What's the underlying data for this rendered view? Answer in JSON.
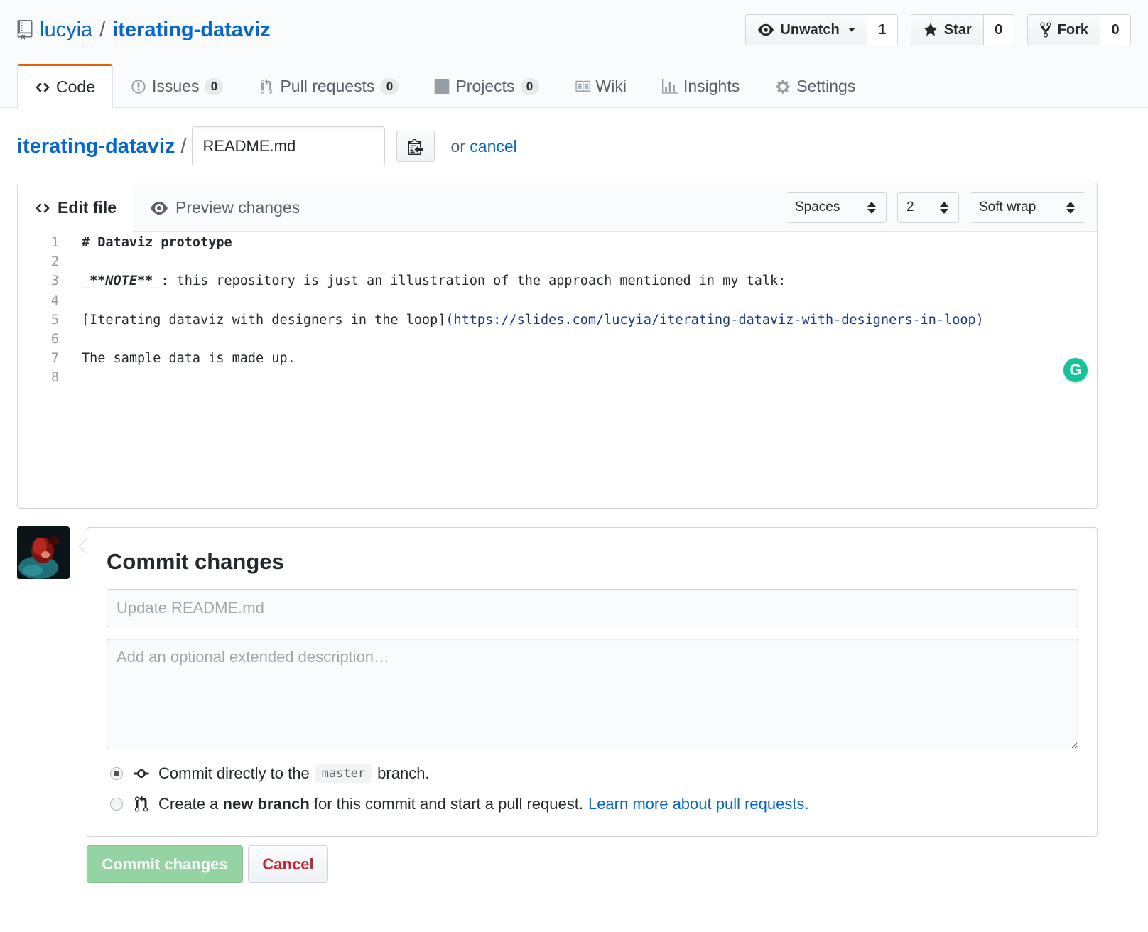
{
  "repo": {
    "owner": "lucyia",
    "separator": "/",
    "name": "iterating-dataviz"
  },
  "actions": {
    "watch": {
      "label": "Unwatch",
      "count": "1"
    },
    "star": {
      "label": "Star",
      "count": "0"
    },
    "fork": {
      "label": "Fork",
      "count": "0"
    }
  },
  "nav": {
    "code": "Code",
    "issues": "Issues",
    "issues_count": "0",
    "pulls": "Pull requests",
    "pulls_count": "0",
    "projects": "Projects",
    "projects_count": "0",
    "wiki": "Wiki",
    "insights": "Insights",
    "settings": "Settings"
  },
  "path": {
    "repo_link": "iterating-dataviz",
    "slash": "/",
    "filename": "README.md",
    "or": "or",
    "cancel": "cancel"
  },
  "editor": {
    "tab_edit": "Edit file",
    "tab_preview": "Preview changes",
    "indent_mode": "Spaces",
    "indent_size": "2",
    "wrap_mode": "Soft wrap",
    "lines": [
      {
        "n": "1",
        "parts": [
          {
            "t": "# Dataviz prototype",
            "s": "h1"
          }
        ]
      },
      {
        "n": "2",
        "parts": []
      },
      {
        "n": "3",
        "parts": [
          {
            "t": "_",
            "s": ""
          },
          {
            "t": "**NOTE**",
            "s": "bi"
          },
          {
            "t": "_: this repository is just an illustration of the approach mentioned in my talk:",
            "s": ""
          }
        ]
      },
      {
        "n": "4",
        "parts": []
      },
      {
        "n": "5",
        "parts": [
          {
            "t": "[Iterating dataviz with designers in the loop]",
            "s": "ul"
          },
          {
            "t": "(https://slides.com/lucyia/iterating-dataviz-with-designers-in-loop)",
            "s": "url"
          }
        ]
      },
      {
        "n": "6",
        "parts": []
      },
      {
        "n": "7",
        "parts": [
          {
            "t": "The sample data is made up.",
            "s": ""
          }
        ]
      },
      {
        "n": "8",
        "parts": []
      }
    ]
  },
  "commit": {
    "title": "Commit changes",
    "summary_placeholder": "Update README.md",
    "description_placeholder": "Add an optional extended description…",
    "option_direct_prefix": "Commit directly to the",
    "option_direct_branch": "master",
    "option_direct_suffix": "branch.",
    "option_new_prefix": "Create a",
    "option_new_bold": "new branch",
    "option_new_suffix": "for this commit and start a pull request.",
    "option_new_link": "Learn more about pull requests.",
    "selected_option": "direct",
    "submit_label": "Commit changes",
    "cancel_label": "Cancel"
  },
  "colors": {
    "link": "#0366d6",
    "accent_tab": "#e36209",
    "commit_button": "#94d3a2",
    "cancel_text": "#cb2431",
    "grammarly": "#15c39a"
  }
}
